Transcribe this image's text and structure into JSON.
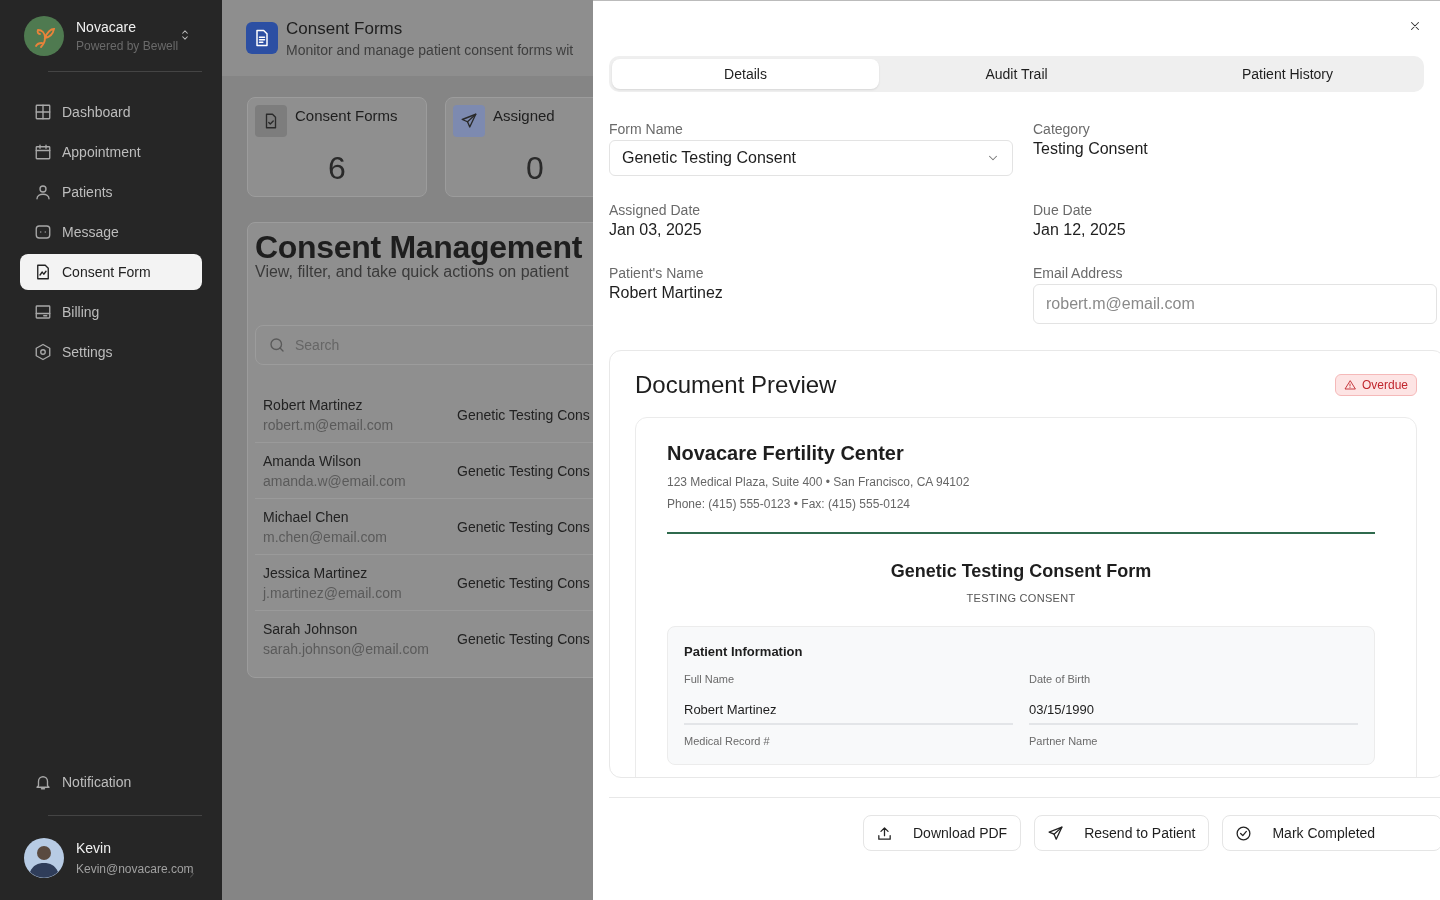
{
  "sidebar": {
    "brand": {
      "name": "Novacare",
      "tagline": "Powered by Bewell"
    },
    "nav": [
      {
        "label": "Dashboard",
        "kind": "grid",
        "selected": false
      },
      {
        "label": "Appointment",
        "kind": "calendar",
        "selected": false
      },
      {
        "label": "Patients",
        "kind": "person",
        "selected": false
      },
      {
        "label": "Message",
        "kind": "message",
        "selected": false
      },
      {
        "label": "Consent Form",
        "kind": "document",
        "selected": true
      },
      {
        "label": "Billing",
        "kind": "card",
        "selected": false
      },
      {
        "label": "Settings",
        "kind": "settings",
        "selected": false
      }
    ],
    "footer_nav": [
      {
        "label": "Notification",
        "kind": "bell",
        "selected": false
      }
    ],
    "user": {
      "name": "Kevin",
      "email": "Kevin@novacare.com"
    }
  },
  "page_header": {
    "title": "Consent Forms",
    "subtitle": "Monitor and manage patient consent forms wit"
  },
  "stats": [
    {
      "label": "Consent Forms",
      "value": "6",
      "kind": "document"
    },
    {
      "label": "Assigned",
      "value": "0",
      "kind": "send"
    }
  ],
  "consent_list": {
    "title": "Consent Management",
    "subtitle": "View, filter, and take quick actions on patient",
    "search": {
      "placeholder": "Search"
    },
    "rows": [
      {
        "name": "Robert Martinez",
        "email": "robert.m@email.com",
        "form": "Genetic Testing Cons"
      },
      {
        "name": "Amanda Wilson",
        "email": "amanda.w@email.com",
        "form": "Genetic Testing Cons"
      },
      {
        "name": "Michael Chen",
        "email": "m.chen@email.com",
        "form": "Genetic Testing Cons"
      },
      {
        "name": "Jessica Martinez",
        "email": "j.martinez@email.com",
        "form": "Genetic Testing Cons"
      },
      {
        "name": "Sarah Johnson",
        "email": "sarah.johnson@email.com",
        "form": "Genetic Testing Cons"
      }
    ]
  },
  "drawer": {
    "tabs": [
      {
        "label": "Details",
        "selected": true
      },
      {
        "label": "Audit Trail",
        "selected": false
      },
      {
        "label": "Patient History",
        "selected": false
      }
    ],
    "fields": [
      {
        "label": "Form Name",
        "value": "Genetic Testing Consent",
        "kind": "select"
      },
      {
        "label": "Category",
        "value": "Testing Consent",
        "kind": "text"
      },
      {
        "label": "Assigned Date",
        "value": "Jan 03, 2025",
        "kind": "text"
      },
      {
        "label": "Due Date",
        "value": "Jan 12, 2025",
        "kind": "text"
      },
      {
        "label": "Patient's Name",
        "value": "Robert Martinez",
        "kind": "text"
      },
      {
        "label": "Email Address",
        "placeholder": "robert.m@email.com",
        "kind": "input"
      }
    ],
    "preview": {
      "title": "Document Preview",
      "status": "Overdue",
      "document": {
        "organization": "Novacare Fertility Center",
        "address": "123 Medical Plaza, Suite 400 • San Francisco, CA 94102",
        "contact": "Phone: (415) 555-0123 • Fax: (415) 555-0124",
        "form_title": "Genetic Testing Consent Form",
        "form_category": "TESTING CONSENT",
        "section": {
          "title": "Patient Information",
          "fields": [
            {
              "label": "Full Name",
              "value": "Robert Martinez"
            },
            {
              "label": "Date of Birth",
              "value": "03/15/1990"
            },
            {
              "label": "Medical Record #"
            },
            {
              "label": "Partner Name"
            }
          ]
        }
      }
    },
    "actions": [
      {
        "label": "Download PDF",
        "kind": "download"
      },
      {
        "label": "Resend to Patient",
        "kind": "send"
      },
      {
        "label": "Mark Completed",
        "kind": "complete"
      }
    ]
  }
}
